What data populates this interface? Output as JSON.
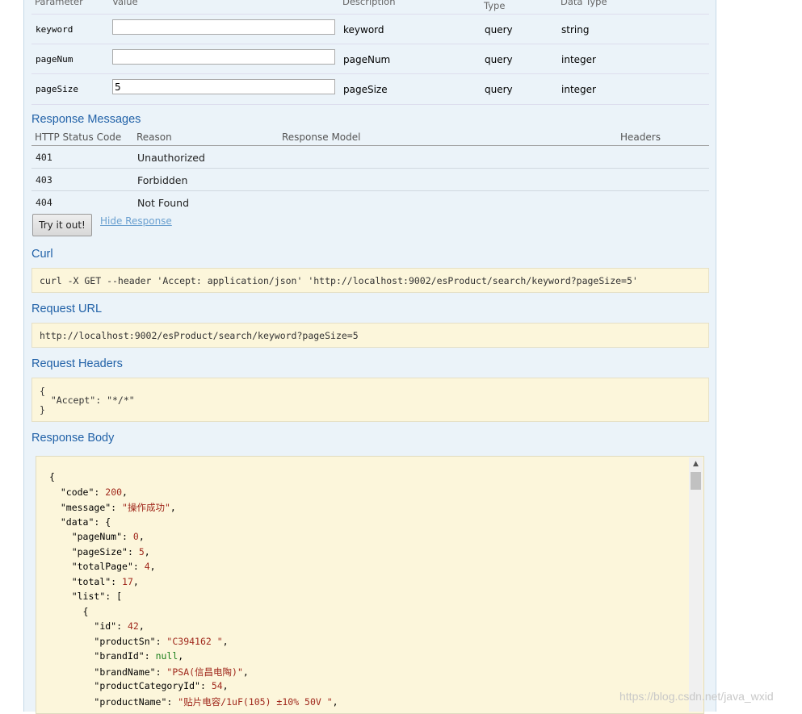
{
  "params_table": {
    "headers": {
      "parameter": "Parameter",
      "value": "Value",
      "description": "Description",
      "type": "Type",
      "data_type": "Data Type"
    },
    "rows": [
      {
        "name": "keyword",
        "value": "",
        "description": "keyword",
        "param_type": "query",
        "data_type": "string"
      },
      {
        "name": "pageNum",
        "value": "",
        "description": "pageNum",
        "param_type": "query",
        "data_type": "integer"
      },
      {
        "name": "pageSize",
        "value": "5",
        "description": "pageSize",
        "param_type": "query",
        "data_type": "integer"
      }
    ]
  },
  "response_messages": {
    "title": "Response Messages",
    "headers": {
      "status": "HTTP Status Code",
      "reason": "Reason",
      "model": "Response Model",
      "headers": "Headers"
    },
    "rows": [
      {
        "code": "401",
        "reason": "Unauthorized"
      },
      {
        "code": "403",
        "reason": "Forbidden"
      },
      {
        "code": "404",
        "reason": "Not Found"
      }
    ]
  },
  "actions": {
    "try_label": "Try it out!",
    "hide_label": "Hide Response"
  },
  "curl": {
    "title": "Curl",
    "command": "curl -X GET --header 'Accept: application/json' 'http://localhost:9002/esProduct/search/keyword?pageSize=5'"
  },
  "request_url": {
    "title": "Request URL",
    "url": "http://localhost:9002/esProduct/search/keyword?pageSize=5"
  },
  "request_headers": {
    "title": "Request Headers",
    "lines": [
      "{",
      "  \"Accept\": \"*/*\"",
      "}"
    ]
  },
  "response_body": {
    "title": "Response Body",
    "lines": [
      {
        "text": "{",
        "key": "",
        "value": "",
        "kind": ""
      },
      {
        "key": "\"code\"",
        "value": "200",
        "kind": "num",
        "trail": ",",
        "indent": "  "
      },
      {
        "key": "\"message\"",
        "value": "\"操作成功\"",
        "kind": "str",
        "trail": ",",
        "indent": "  "
      },
      {
        "key": "\"data\"",
        "value": "{",
        "kind": "",
        "trail": "",
        "indent": "  "
      },
      {
        "key": "\"pageNum\"",
        "value": "0",
        "kind": "num",
        "trail": ",",
        "indent": "    "
      },
      {
        "key": "\"pageSize\"",
        "value": "5",
        "kind": "num",
        "trail": ",",
        "indent": "    "
      },
      {
        "key": "\"totalPage\"",
        "value": "4",
        "kind": "num",
        "trail": ",",
        "indent": "    "
      },
      {
        "key": "\"total\"",
        "value": "17",
        "kind": "num",
        "trail": ",",
        "indent": "    "
      },
      {
        "key": "\"list\"",
        "value": "[",
        "kind": "",
        "trail": "",
        "indent": "    "
      },
      {
        "text": "      {",
        "key": "",
        "value": "",
        "kind": ""
      },
      {
        "key": "\"id\"",
        "value": "42",
        "kind": "num",
        "trail": ",",
        "indent": "        "
      },
      {
        "key": "\"productSn\"",
        "value": "\"C394162 \"",
        "kind": "str",
        "trail": ",",
        "indent": "        "
      },
      {
        "key": "\"brandId\"",
        "value": "null",
        "kind": "nul",
        "trail": ",",
        "indent": "        "
      },
      {
        "key": "\"brandName\"",
        "value": "\"PSA(信昌电陶)\"",
        "kind": "str",
        "trail": ",",
        "indent": "        "
      },
      {
        "key": "\"productCategoryId\"",
        "value": "54",
        "kind": "num",
        "trail": ",",
        "indent": "        "
      },
      {
        "key": "\"productName\"",
        "value": "\"贴片电容/1uF(105) ±10% 50V \"",
        "kind": "str",
        "trail": ",",
        "indent": "        "
      }
    ]
  },
  "watermark": "https://blog.csdn.net/java_wxid"
}
